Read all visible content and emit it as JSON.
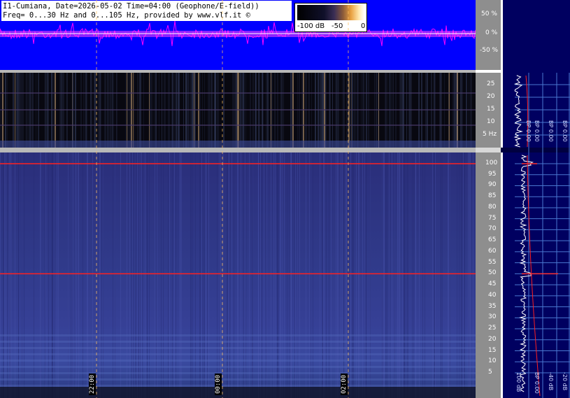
{
  "header": {
    "line1": "I1-Cumiana, Date=2026-05-02 Time=04:00 (Geophone/E-field))",
    "line2": "Freq= 0...30 Hz and 0...105 Hz, provided by www.vlf.it ©"
  },
  "legend": {
    "labels": [
      "-100 dB",
      "-50",
      "0"
    ]
  },
  "scope": {
    "tick_labels": [
      "50 %",
      "0 %",
      "-50 %"
    ]
  },
  "chart_data": [
    {
      "type": "line",
      "panel": "amplitude-scope",
      "ylabel": "",
      "yticks": [
        50,
        0,
        -50
      ],
      "ylim": [
        -100,
        100
      ],
      "description_colors": {
        "trace": "#ff00ff",
        "background": "#0000ff"
      }
    },
    {
      "type": "heatmap",
      "panel": "spectrogram-low",
      "yticks": [
        25,
        20,
        15,
        10,
        5
      ],
      "tick_labels": [
        "25",
        "20",
        "15",
        "10",
        "5 Hz"
      ],
      "ylim": [
        0,
        30
      ],
      "time_marks": [
        "22:00",
        "00:00",
        "02:00"
      ]
    },
    {
      "type": "heatmap",
      "panel": "spectrogram-high",
      "yticks": [
        100,
        95,
        90,
        85,
        80,
        75,
        70,
        65,
        60,
        55,
        50,
        45,
        40,
        35,
        30,
        25,
        20,
        15,
        10,
        5
      ],
      "ylim": [
        0,
        105
      ],
      "lines": [
        {
          "freq": 100,
          "color": "#ff2020"
        },
        {
          "freq": 50,
          "color": "#ff2020"
        }
      ],
      "time_marks": [
        "22:00",
        "00:00",
        "02:00"
      ]
    }
  ],
  "time_marks": [
    "22:00",
    "00:00",
    "02:00"
  ],
  "side_panel": {
    "labels_top": [
      "BP 0.00",
      "BP 0.00",
      "BP 0.00",
      "BP 0.00"
    ],
    "labels_bottom": [
      "100 dB",
      "BP 0.00",
      "-40 dB",
      "-20 dB"
    ]
  }
}
